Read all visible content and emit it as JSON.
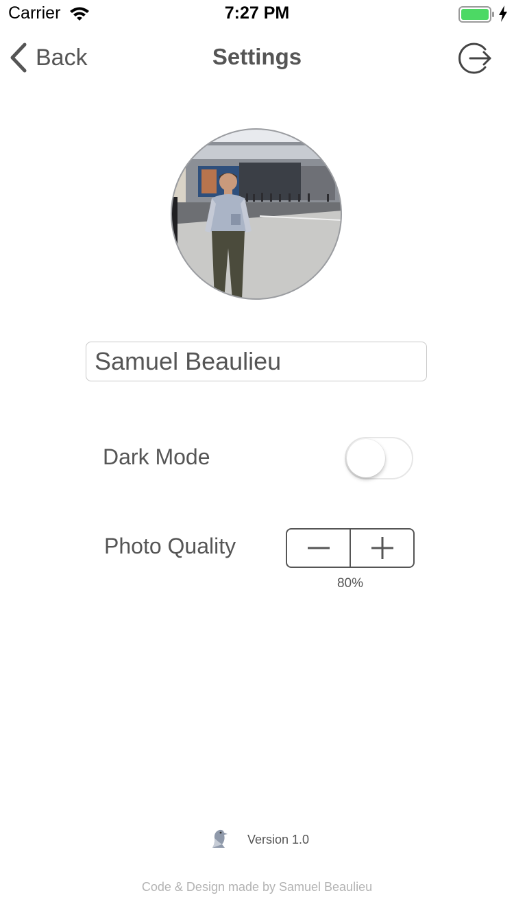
{
  "status_bar": {
    "carrier": "Carrier",
    "time": "7:27 PM",
    "battery_color": "#4cd964"
  },
  "nav": {
    "back_label": "Back",
    "title": "Settings",
    "back_icon": "chevron-left-icon",
    "logout_icon": "logout-icon"
  },
  "profile": {
    "name_value": "Samuel Beaulieu",
    "avatar": "profile-photo"
  },
  "settings": {
    "dark_mode_label": "Dark Mode",
    "dark_mode_on": false,
    "photo_quality_label": "Photo Quality",
    "photo_quality_value": "80%",
    "decrement_icon": "minus-icon",
    "increment_icon": "plus-icon"
  },
  "footer": {
    "version": "Version 1.0",
    "logo_icon": "bird-logo-icon",
    "credits": "Code & Design made by Samuel Beaulieu"
  },
  "colors": {
    "text": "#555555",
    "credits": "#b3b3b3",
    "border": "#c8c8c8"
  }
}
